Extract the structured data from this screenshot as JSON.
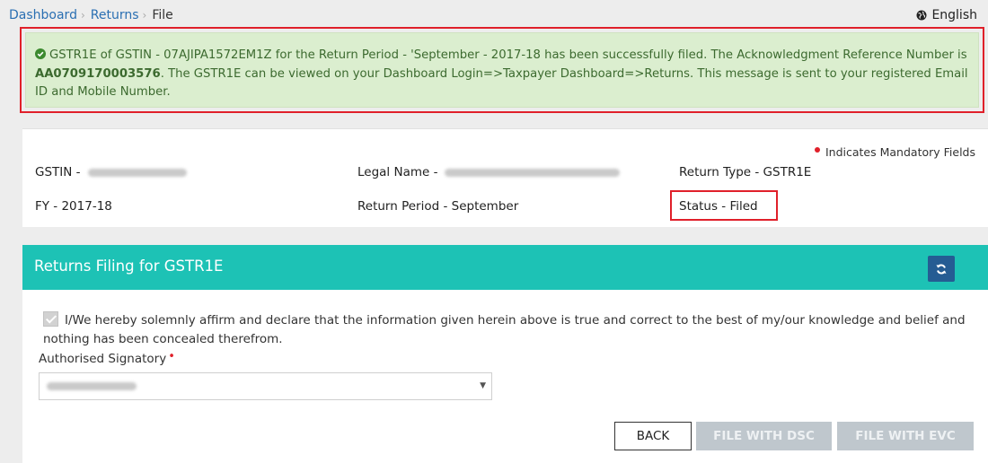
{
  "breadcrumb": {
    "items": [
      "Dashboard",
      "Returns"
    ],
    "current": "File"
  },
  "language": "English",
  "alert": {
    "part1": "GSTR1E of GSTIN - 07AJIPA1572EM1Z for the Return Period - 'September - 2017-18 has been successfully filed. The Acknowledgment Reference Number is ",
    "ack_number": "AA0709170003576",
    "part2": ". The GSTR1E can be viewed on your Dashboard Login=>Taxpayer Dashboard=>Returns. This message is sent to your registered Email ID and Mobile Number."
  },
  "info": {
    "mandatory_note": "Indicates Mandatory Fields",
    "gstin_label": "GSTIN -",
    "legal_name_label": "Legal Name -",
    "return_type": "Return Type - GSTR1E",
    "fy": "FY - 2017-18",
    "return_period": "Return Period - September",
    "status": "Status - Filed"
  },
  "panel": {
    "title": "Returns Filing for GSTR1E",
    "declaration": "I/We hereby solemnly affirm and declare that the information given herein above is true and correct to the best of my/our knowledge and belief and nothing has been concealed therefrom.",
    "declaration_checked": true,
    "signatory_label": "Authorised Signatory",
    "required_mark": "•"
  },
  "buttons": {
    "back": "BACK",
    "file_dsc": "FILE WITH DSC",
    "file_evc": "FILE WITH EVC"
  },
  "colors": {
    "header_teal": "#1dc2b5",
    "success_bg": "#dbeecf",
    "success_text": "#3c6a2f",
    "highlight_red": "#e0202a",
    "refresh_button": "#255c93",
    "disabled_button": "#bfc7cd"
  }
}
